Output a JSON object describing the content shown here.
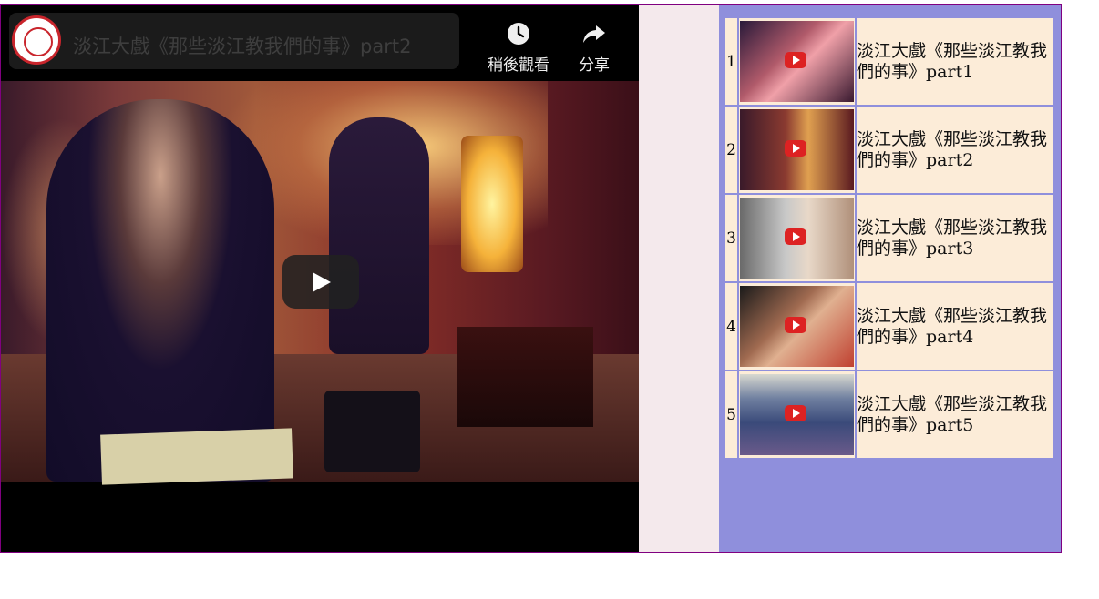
{
  "player": {
    "title": "淡江大戲《那些淡江教我們的事》part2",
    "channel_avatar_icon": "tamkang-university-seal-icon",
    "actions": {
      "watch_later_label": "稍後觀看",
      "watch_later_icon": "clock-icon",
      "share_label": "分享",
      "share_icon": "share-arrow-icon"
    },
    "play_icon": "play-icon"
  },
  "playlist": {
    "items": [
      {
        "index": "1",
        "title": "淡江大戲《那些淡江教我們的事》part1",
        "thumb_icon": "video-thumbnail"
      },
      {
        "index": "2",
        "title": "淡江大戲《那些淡江教我們的事》part2",
        "thumb_icon": "video-thumbnail"
      },
      {
        "index": "3",
        "title": "淡江大戲《那些淡江教我們的事》part3",
        "thumb_icon": "video-thumbnail"
      },
      {
        "index": "4",
        "title": "淡江大戲《那些淡江教我們的事》part4",
        "thumb_icon": "video-thumbnail"
      },
      {
        "index": "5",
        "title": "淡江大戲《那些淡江教我們的事》part5",
        "thumb_icon": "video-thumbnail"
      }
    ]
  },
  "colors": {
    "frame_border": "#800080",
    "playlist_bg": "#8f8fdc",
    "cell_bg": "#fcecd8",
    "page_bg": "#f4e9ec"
  }
}
